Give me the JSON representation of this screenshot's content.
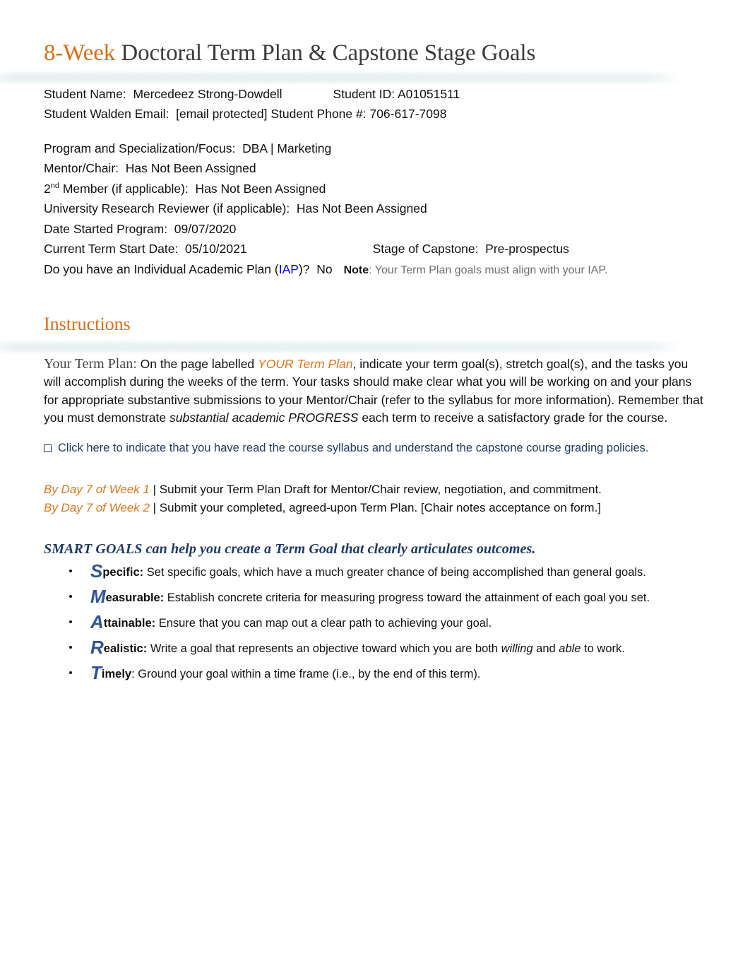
{
  "document": {
    "title_accent": "8-Week",
    "title_rest": " Doctoral Term Plan & Capstone Stage Goals"
  },
  "student_info": {
    "name_label": "Student Name:  ",
    "name_value": "Mercedeez Strong-Dowdell",
    "id_label": "Student ID: ",
    "id_value": "A01051511",
    "email_label": "Student Walden Email:  ",
    "email_value": "[email protected]",
    "phone_label": "Student Phone #: ",
    "phone_value": "706-617-7098"
  },
  "program_info": {
    "program_line": "Program and Specialization/Focus:  DBA | Marketing",
    "mentor_line": "Mentor/Chair:  Has Not Been Assigned",
    "second_member_prefix": "2",
    "second_member_sup": "nd",
    "second_member_rest": " Member (if applicable):  Has Not Been Assigned",
    "reviewer_line": "University Research Reviewer (if applicable):  Has Not Been Assigned",
    "date_started_line": "Date Started Program:  09/07/2020",
    "term_start_line": "Current Term Start Date:  05/10/2021",
    "stage_line": "Stage of Capstone:  Pre-prospectus",
    "iap_prefix": "Do you have an Individual Academic Plan (",
    "iap_link": "IAP",
    "iap_suffix": ")?  No",
    "note_label": "Note",
    "note_text": ": Your Term Plan goals must align with your IAP."
  },
  "instructions": {
    "heading": "Instructions",
    "term_plan_label": "Your Term Plan:",
    "para_part1": " On the page labelled ",
    "para_accent": "YOUR Term Plan",
    "para_part2": ", indicate your term goal(s), stretch goal(s), and the tasks you will accomplish during the weeks of the term. Your tasks should make clear what you will be working on and your plans for appropriate substantive submissions to your Mentor/Chair (refer to the syllabus for more information). Remember that you must demonstrate ",
    "para_italic": "substantial academic PROGRESS",
    "para_part3": " each term to receive a satisfactory grade for the course.",
    "checkbox_label": "Click here to indicate that you have read the course syllabus and understand the capstone course grading policies.",
    "day_lines": [
      {
        "accent": "By Day 7 of Week 1",
        "rest": " | Submit your Term Plan Draft for Mentor/Chair review, negotiation, and commitment."
      },
      {
        "accent": "By Day 7 of Week 2",
        "rest": " | Submit your completed, agreed-upon Term Plan. [Chair notes acceptance on form.]"
      }
    ]
  },
  "smart": {
    "heading": "SMART GOALS can help you create a Term Goal that clearly articulates outcomes.",
    "items": [
      {
        "cap": "S",
        "word": "pecific:",
        "desc_pre": " Set specific goals, which have a much greater chance of being accomplished than general goals.",
        "desc_italic": "",
        "desc_post": ""
      },
      {
        "cap": "M",
        "word": "easurable:",
        "desc_pre": " Establish concrete criteria for measuring progress toward the attainment of each goal you set.",
        "desc_italic": "",
        "desc_post": ""
      },
      {
        "cap": "A",
        "word": "ttainable:",
        "desc_pre": " Ensure that you can map out a clear path to achieving your goal.",
        "desc_italic": "",
        "desc_post": ""
      },
      {
        "cap": "R",
        "word": "ealistic:",
        "desc_pre": " Write a goal that represents an objective toward which you are both ",
        "desc_italic": "willing",
        "desc_mid": " and ",
        "desc_italic2": "able",
        "desc_post": " to work."
      },
      {
        "cap": "T",
        "word": "imely",
        "desc_pre": ": Ground your goal within a time frame (i.e., by the end of this term).",
        "desc_italic": "",
        "desc_post": ""
      }
    ]
  },
  "colors": {
    "accent_orange": "#DE6B10",
    "navy": "#1F3864",
    "cap_blue": "#2E5496",
    "link_blue": "#0000FF",
    "note_gray": "#6E6E6E"
  }
}
